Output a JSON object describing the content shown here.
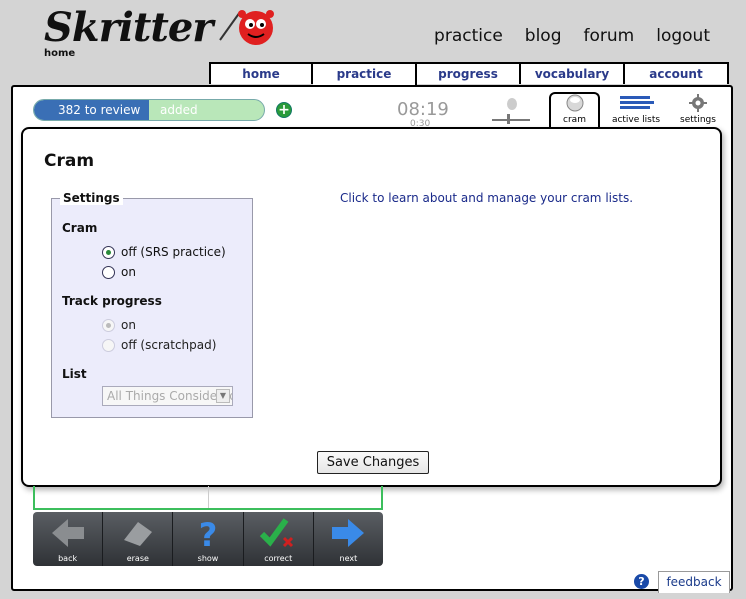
{
  "header": {
    "logo_text": "Skritter",
    "logo_sub": "home",
    "nav": [
      "practice",
      "blog",
      "forum",
      "logout"
    ]
  },
  "tabs": [
    {
      "label": "home",
      "active": false
    },
    {
      "label": "practice",
      "active": true
    },
    {
      "label": "progress",
      "active": false
    },
    {
      "label": "vocabulary",
      "active": false
    },
    {
      "label": "account",
      "active": false
    }
  ],
  "toolbar_top": {
    "review_label": "382 to review",
    "added_label": "added",
    "add_icon": "plus-icon",
    "timer": "08:19",
    "timer_sub": "0:30",
    "icons": [
      {
        "name": "cram-icon",
        "label": "cram"
      },
      {
        "name": "active-lists-icon",
        "label": "active lists"
      },
      {
        "name": "settings-icon",
        "label": "settings"
      }
    ]
  },
  "dialog": {
    "title": "Cram",
    "settings_legend": "Settings",
    "cram_label": "Cram",
    "cram_options": [
      {
        "label": "off (SRS practice)",
        "checked": true
      },
      {
        "label": "on",
        "checked": false
      }
    ],
    "track_label": "Track progress",
    "track_options": [
      {
        "label": "on",
        "checked": true
      },
      {
        "label": "off (scratchpad)",
        "checked": false
      }
    ],
    "list_label": "List",
    "list_value": "All Things Considered",
    "learn_link": "Click to learn about and manage your cram lists.",
    "save_label": "Save Changes"
  },
  "bottom_toolbar": [
    {
      "name": "back",
      "label": "back"
    },
    {
      "name": "erase",
      "label": "erase"
    },
    {
      "name": "show",
      "label": "show"
    },
    {
      "name": "correct",
      "label": "correct"
    },
    {
      "name": "next",
      "label": "next"
    }
  ],
  "feedback_label": "feedback",
  "help_glyph": "?",
  "colors": {
    "accent": "#2a3a8a",
    "review_blue": "#3a6fb5",
    "green": "#3cbe5c"
  }
}
